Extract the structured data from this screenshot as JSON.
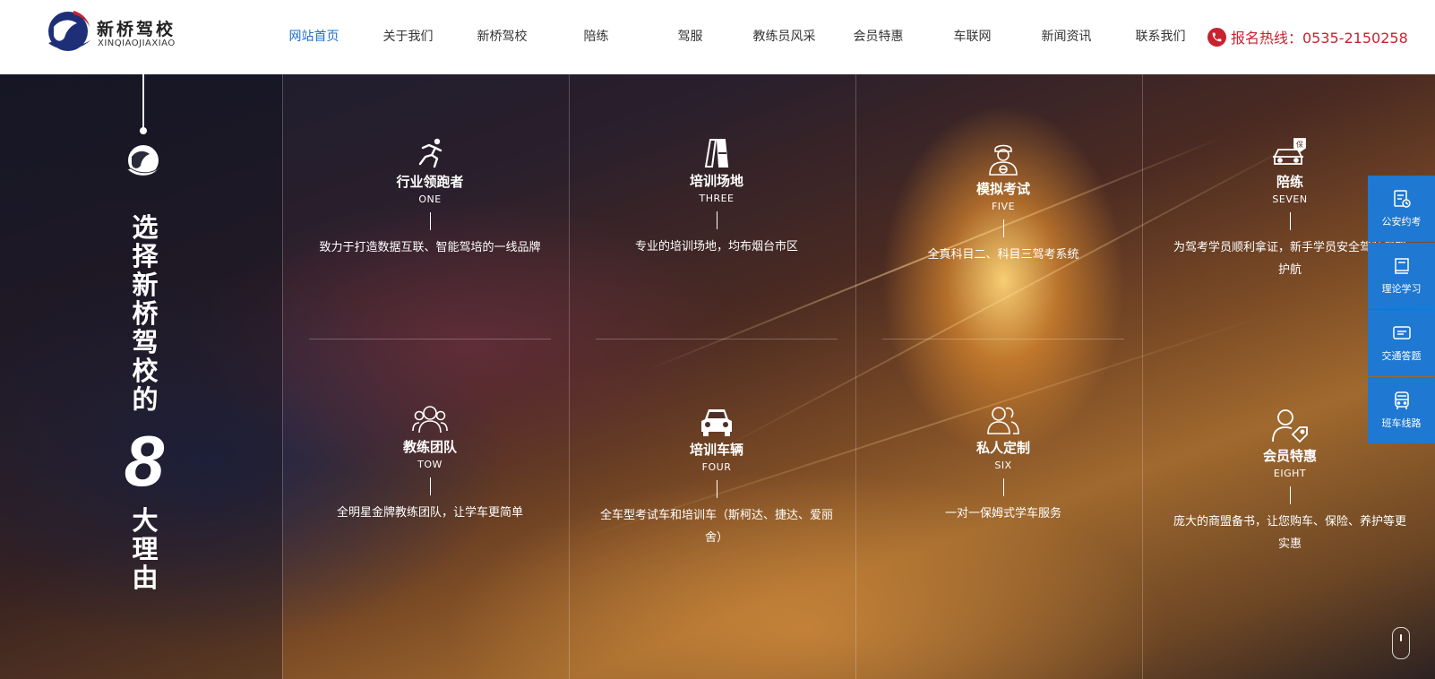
{
  "header": {
    "logo": {
      "name": "新桥驾校",
      "sub": "XINQIAOJIAXIAO"
    },
    "nav": [
      {
        "label": "网站首页",
        "active": true
      },
      {
        "label": "关于我们"
      },
      {
        "label": "新桥驾校"
      },
      {
        "label": "陪练"
      },
      {
        "label": "驾服"
      },
      {
        "label": "教练员风采"
      },
      {
        "label": "会员特惠"
      },
      {
        "label": "车联网"
      },
      {
        "label": "新闻资讯"
      },
      {
        "label": "联系我们"
      }
    ],
    "hotline": "报名热线：0535-2150258",
    "hotline_icon": "phone-icon",
    "accent_color": "#c8222f",
    "active_color": "#1e6fc8"
  },
  "hero": {
    "title_top": "选择新桥驾校的",
    "number": "8",
    "title_bottom": "大理由",
    "features": [
      {
        "icon": "running-man-icon",
        "title": "行业领跑者",
        "sub": "ONE",
        "desc": "致力于打造数据互联、智能驾培的一线品牌"
      },
      {
        "icon": "road-icon",
        "title": "培训场地",
        "sub": "THREE",
        "desc": "专业的培训场地，均布烟台市区"
      },
      {
        "icon": "examiner-icon",
        "title": "模拟考试",
        "sub": "FIVE",
        "desc": "全真科目二、科目三驾考系统"
      },
      {
        "icon": "insured-car-icon",
        "title": "陪练",
        "sub": "SEVEN",
        "desc": "为驾考学员顺利拿证，新手学员安全驾驶保驾护航"
      },
      {
        "icon": "team-icon",
        "title": "教练团队",
        "sub": "TOW",
        "desc": "全明星金牌教练团队，让学车更简单"
      },
      {
        "icon": "car-front-icon",
        "title": "培训车辆",
        "sub": "FOUR",
        "desc": "全车型考试车和培训车（斯柯达、捷达、爱丽舍）"
      },
      {
        "icon": "private-users-icon",
        "title": "私人定制",
        "sub": "SIX",
        "desc": "一对一保姆式学车服务"
      },
      {
        "icon": "member-tag-icon",
        "title": "会员特惠",
        "sub": "EIGHT",
        "desc": "庞大的商盟备书，让您购车、保险、养护等更实惠"
      }
    ]
  },
  "sidebar": {
    "color": "#1f78d1",
    "items": [
      {
        "icon": "appointment-icon",
        "label": "公安约考"
      },
      {
        "icon": "book-icon",
        "label": "理论学习"
      },
      {
        "icon": "chat-icon",
        "label": "交通答题"
      },
      {
        "icon": "bus-icon",
        "label": "班车线路"
      }
    ]
  }
}
